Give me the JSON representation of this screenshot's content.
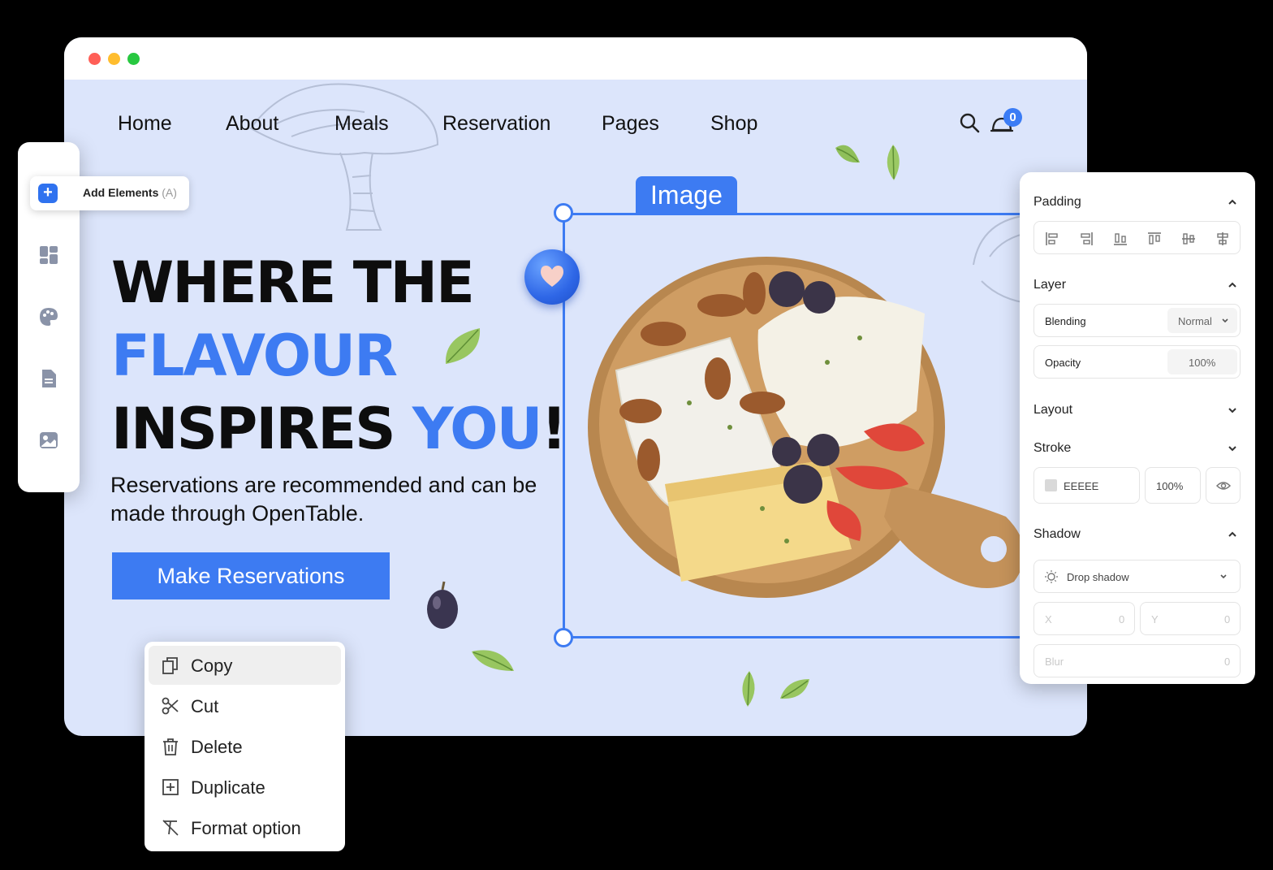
{
  "colors": {
    "accent": "#3d7bf2",
    "page_bg": "#dce5fb",
    "window_bg": "#ffffff"
  },
  "nav": {
    "items": [
      "Home",
      "About",
      "Meals",
      "Reservation",
      "Pages",
      "Shop"
    ],
    "cart_count": "0",
    "icons": [
      "search-icon",
      "cart-icon"
    ]
  },
  "hero": {
    "line1": "WHERE THE",
    "line2": "FLAVOUR",
    "line3_a": "INSPIRES ",
    "line3_b": "YOU",
    "line3_c": "!",
    "subtitle": "Reservations are recommended and can be made through OpenTable.",
    "cta": "Make Reservations"
  },
  "selection": {
    "label": "Image"
  },
  "toolbar": {
    "add_label": "Add Elements",
    "add_shortcut": "(A)",
    "icons": [
      "add-icon",
      "dashboard-icon",
      "palette-icon",
      "document-icon",
      "image-icon"
    ]
  },
  "context_menu": {
    "items": [
      {
        "label": "Copy",
        "icon": "copy-icon"
      },
      {
        "label": "Cut",
        "icon": "scissors-icon"
      },
      {
        "label": "Delete",
        "icon": "trash-icon"
      },
      {
        "label": "Duplicate",
        "icon": "plus-square-icon"
      },
      {
        "label": "Format option",
        "icon": "clear-format-icon"
      }
    ]
  },
  "panel": {
    "padding": {
      "title": "Padding"
    },
    "layer": {
      "title": "Layer",
      "blending_label": "Blending",
      "blending_value": "Normal",
      "opacity_label": "Opacity",
      "opacity_value": "100%"
    },
    "layout": {
      "title": "Layout"
    },
    "stroke": {
      "title": "Stroke",
      "color": "EEEEE",
      "opacity": "100%"
    },
    "shadow": {
      "title": "Shadow",
      "type": "Drop shadow",
      "x_label": "X",
      "x_value": "0",
      "y_label": "Y",
      "y_value": "0",
      "blur_label": "Blur",
      "blur_value": "0"
    }
  }
}
